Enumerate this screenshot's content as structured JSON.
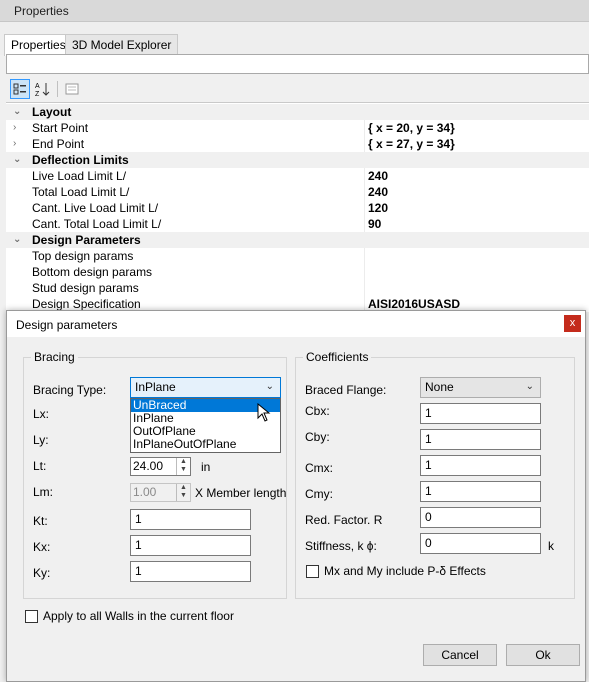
{
  "panel": {
    "title": "Properties"
  },
  "tabs": [
    {
      "label": "Properties"
    },
    {
      "label": "3D Model Explorer"
    }
  ],
  "search": {
    "value": ""
  },
  "grid": {
    "layout": {
      "label": "Layout"
    },
    "start_point": {
      "label": "Start Point",
      "value": "{ x = 20, y = 34}"
    },
    "end_point": {
      "label": "End Point",
      "value": "{ x = 27, y = 34}"
    },
    "deflection": {
      "label": "Deflection Limits"
    },
    "live_load": {
      "label": "Live Load Limit L/",
      "value": "240"
    },
    "total_load": {
      "label": "Total Load Limit L/",
      "value": "240"
    },
    "cant_live": {
      "label": "Cant. Live Load Limit L/",
      "value": "120"
    },
    "cant_total": {
      "label": "Cant. Total Load Limit L/",
      "value": "90"
    },
    "design_params": {
      "label": "Design Parameters"
    },
    "top_design": {
      "label": "Top design params",
      "value": ""
    },
    "bottom_design": {
      "label": "Bottom design params",
      "value": ""
    },
    "stud_design": {
      "label": "Stud design params",
      "value": ""
    },
    "design_spec": {
      "label": "Design Specification",
      "value": "AISI2016USASD"
    }
  },
  "dialog": {
    "title": "Design parameters",
    "close": "x",
    "bracing": {
      "title": "Bracing",
      "type_label": "Bracing Type:",
      "type_value": "InPlane",
      "options": [
        "UnBraced",
        "InPlane",
        "OutOfPlane",
        "InPlaneOutOfPlane"
      ],
      "highlighted": "UnBraced",
      "lx_label": "Lx:",
      "ly_label": "Ly:",
      "lt_label": "Lt:",
      "lt_value": "24.00",
      "lt_unit": "in",
      "lm_label": "Lm:",
      "lm_value": "1.00",
      "lm_unit": "X Member length",
      "kt_label": "Kt:",
      "kt_value": "1",
      "kx_label": "Kx:",
      "kx_value": "1",
      "ky_label": "Ky:",
      "ky_value": "1"
    },
    "coefficients": {
      "title": "Coefficients",
      "braced_flange_label": "Braced Flange:",
      "braced_flange_value": "None",
      "cbx_label": "Cbx:",
      "cbx_value": "1",
      "cby_label": "Cby:",
      "cby_value": "1",
      "cmx_label": "Cmx:",
      "cmx_value": "1",
      "cmy_label": "Cmy:",
      "cmy_value": "1",
      "red_factor_label": "Red. Factor. R",
      "red_factor_value": "0",
      "stiffness_label": "Stiffness, k ϕ:",
      "stiffness_value": "0",
      "stiffness_unit": "k",
      "pdelta_label": "Mx and My include P-δ Effects"
    },
    "apply_all_label": "Apply to all Walls in the current floor",
    "cancel": "Cancel",
    "ok": "Ok"
  },
  "colors": {
    "selection": "#0078d7",
    "close": "#c42b1c"
  }
}
